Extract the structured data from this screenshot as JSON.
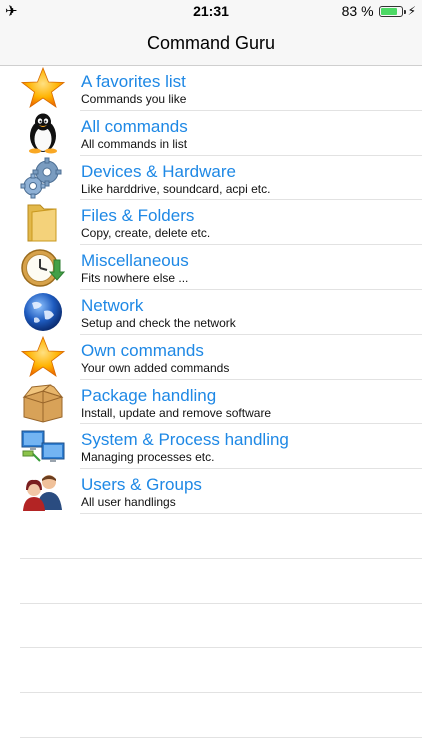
{
  "status_bar": {
    "left_icon": "airplane-icon",
    "time": "21:31",
    "battery_text": "83 %",
    "battery_level": 0.83,
    "charging_icon": "bolt-icon"
  },
  "nav": {
    "title": "Command Guru"
  },
  "items": [
    {
      "title": "A favorites list",
      "subtitle": "Commands you like",
      "icon": "star-icon"
    },
    {
      "title": "All commands",
      "subtitle": "All commands in list",
      "icon": "penguin-icon"
    },
    {
      "title": "Devices & Hardware",
      "subtitle": "Like harddrive, soundcard, acpi etc.",
      "icon": "gears-icon"
    },
    {
      "title": "Files & Folders",
      "subtitle": "Copy, create, delete etc.",
      "icon": "folder-icon"
    },
    {
      "title": "Miscellaneous",
      "subtitle": "Fits nowhere else ...",
      "icon": "clock-icon"
    },
    {
      "title": "Network",
      "subtitle": "Setup and check the network",
      "icon": "globe-icon"
    },
    {
      "title": "Own commands",
      "subtitle": "Your own added commands",
      "icon": "star-icon"
    },
    {
      "title": "Package handling",
      "subtitle": "Install, update and remove software",
      "icon": "package-icon"
    },
    {
      "title": "System & Process handling",
      "subtitle": "Managing processes etc.",
      "icon": "monitors-icon"
    },
    {
      "title": "Users & Groups",
      "subtitle": "All user handlings",
      "icon": "users-icon"
    }
  ],
  "colors": {
    "title_blue": "#1e88e5",
    "battery_green": "#4cd964"
  }
}
